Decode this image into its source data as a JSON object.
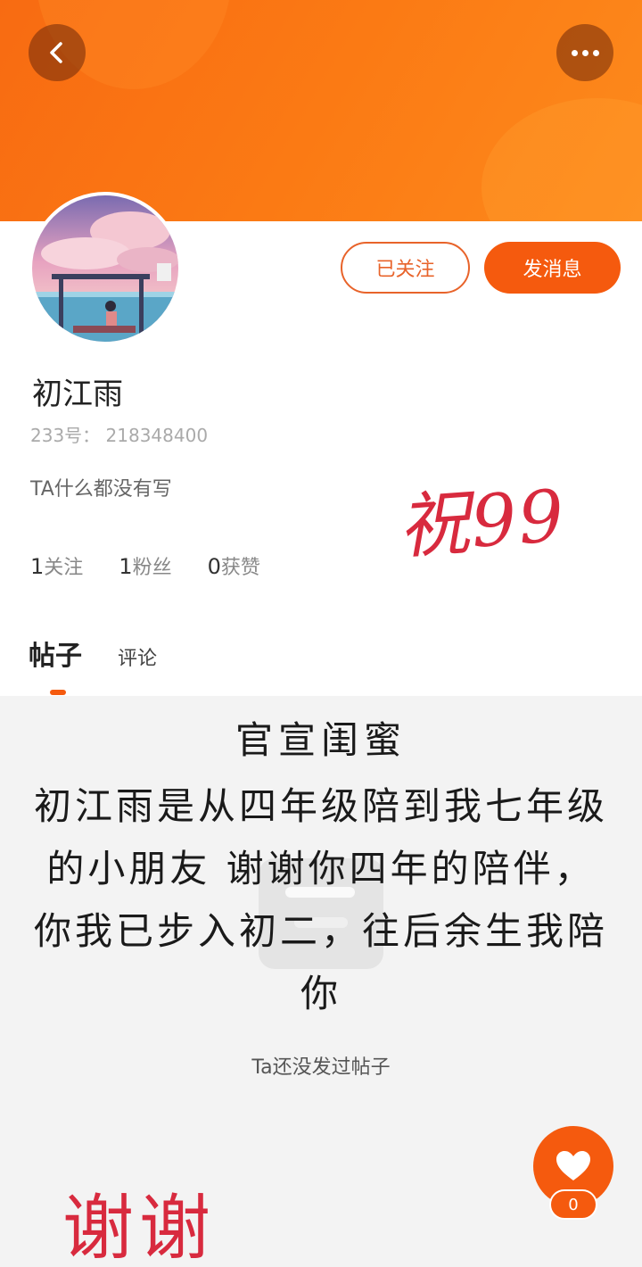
{
  "header": {
    "back_icon": "chevron-left-icon",
    "more_icon": "more-dots-icon"
  },
  "profile": {
    "name": "初江雨",
    "uid_line": "233号： 218348400",
    "bio": "TA什么都没有写",
    "stats": [
      {
        "num": "1",
        "label": "关注"
      },
      {
        "num": "1",
        "label": "粉丝"
      },
      {
        "num": "0",
        "label": "获赞"
      }
    ]
  },
  "actions": {
    "follow_label": "已关注",
    "message_label": "发消息"
  },
  "tabs": [
    {
      "label": "帖子"
    },
    {
      "label": "评论"
    }
  ],
  "empty_state": {
    "text": "Ta还没发过帖子"
  },
  "overlay": {
    "title": "官宣闺蜜",
    "lines": [
      "初江雨是从四年级陪到我七年级",
      "的小朋友 谢谢你四年的陪伴，",
      "你我已步入初二，往后余生我陪",
      "你"
    ]
  },
  "annotations": {
    "top": "祝99",
    "bottom": "谢谢"
  },
  "like": {
    "count": "0",
    "icon": "heart-icon"
  },
  "colors": {
    "accent": "#f55a0e",
    "handwriting_red": "#d82a3e"
  }
}
